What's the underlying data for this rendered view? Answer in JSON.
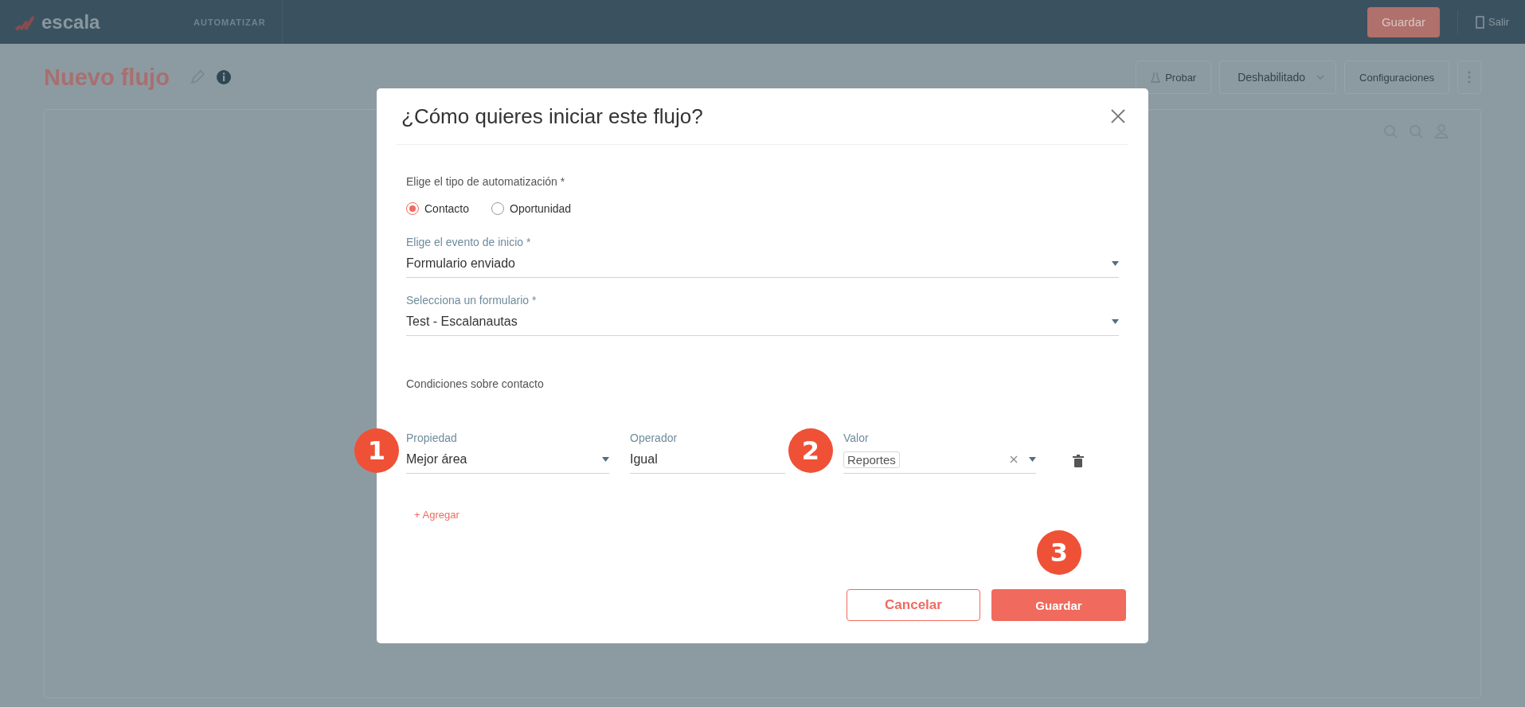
{
  "topbar": {
    "logo_text": "escala",
    "section": "AUTOMATIZAR",
    "save_button": "Guardar",
    "exit_link": "Salir"
  },
  "header": {
    "title": "Nuevo flujo",
    "actions": [
      {
        "kind": "test",
        "label": "Probar"
      },
      {
        "kind": "dropdown",
        "label": "Deshabilitado"
      },
      {
        "kind": "button",
        "label": "Configuraciones"
      },
      {
        "kind": "menu"
      }
    ]
  },
  "modal": {
    "title": "¿Cómo quieres iniciar este flujo?",
    "automation_type": {
      "label": "Elige el tipo de automatización *",
      "options": [
        {
          "label": "Contacto",
          "selected": true
        },
        {
          "label": "Oportunidad",
          "selected": false
        }
      ]
    },
    "start_event": {
      "label": "Elige el evento de inicio *",
      "value": "Formulario enviado"
    },
    "form_select": {
      "label": "Selecciona un formulario *",
      "value": "Test - Escalanautas"
    },
    "conditions": {
      "title": "Condiciones sobre contacto",
      "rows": [
        {
          "property": {
            "label": "Propiedad",
            "value": "Mejor área",
            "callout": "1"
          },
          "operator": {
            "label": "Operador",
            "value": "Igual"
          },
          "value": {
            "label": "Valor",
            "tags": [
              "Reportes"
            ],
            "callout": "2"
          }
        }
      ],
      "add_link": "+ Agregar"
    },
    "buttons": [
      {
        "kind": "secondary",
        "label": "Cancelar"
      },
      {
        "kind": "primary",
        "label": "Guardar",
        "callout": "3"
      }
    ]
  }
}
